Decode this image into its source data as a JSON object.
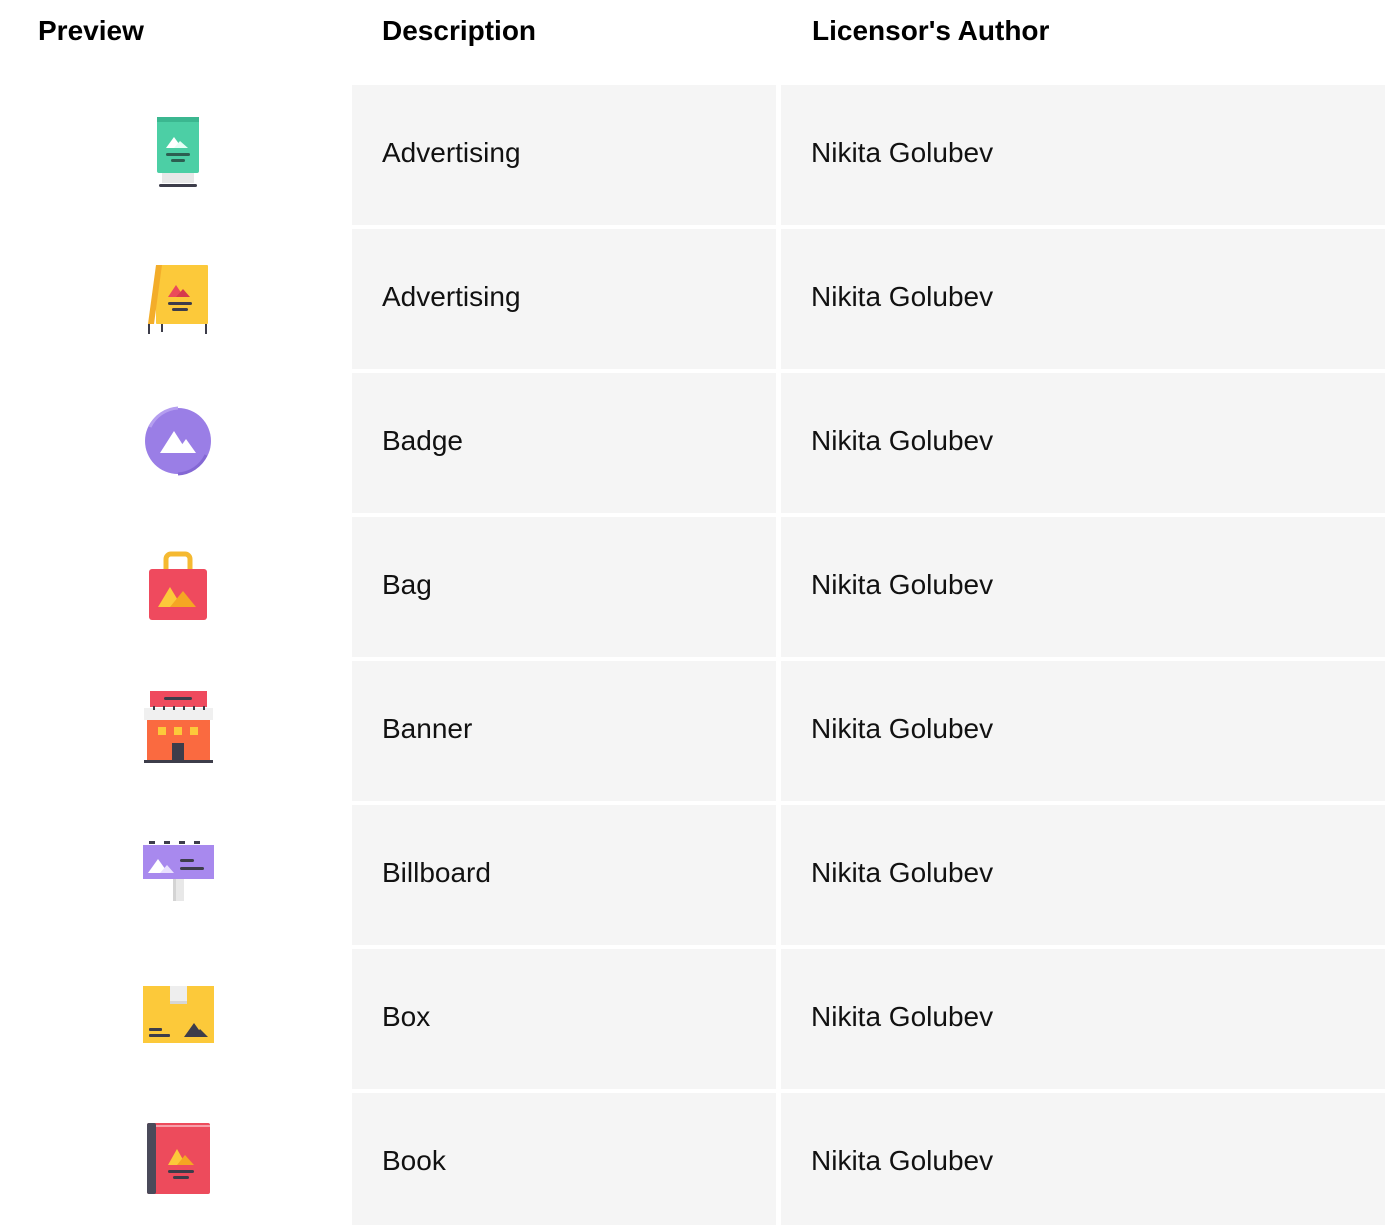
{
  "header": {
    "preview": "Preview",
    "description": "Description",
    "author": "Licensor's Author"
  },
  "rows": [
    {
      "icon": "advertising-stand-icon",
      "description": "Advertising",
      "author": "Nikita Golubev"
    },
    {
      "icon": "advertising-board-icon",
      "description": "Advertising",
      "author": "Nikita Golubev"
    },
    {
      "icon": "badge-icon",
      "description": "Badge",
      "author": "Nikita Golubev"
    },
    {
      "icon": "bag-icon",
      "description": "Bag",
      "author": "Nikita Golubev"
    },
    {
      "icon": "banner-icon",
      "description": "Banner",
      "author": "Nikita Golubev"
    },
    {
      "icon": "billboard-icon",
      "description": "Billboard",
      "author": "Nikita Golubev"
    },
    {
      "icon": "box-icon",
      "description": "Box",
      "author": "Nikita Golubev"
    },
    {
      "icon": "book-icon",
      "description": "Book",
      "author": "Nikita Golubev"
    }
  ],
  "colors": {
    "cell_background": "#f5f5f5",
    "teal": "#4ccfa5",
    "yellow": "#fcc93a",
    "purple": "#9a7ee6",
    "red": "#ef4a5e",
    "orange": "#fa6a40",
    "lavender": "#a889ee",
    "box_yellow": "#fcc93a",
    "book_red": "#ed4b5c"
  }
}
